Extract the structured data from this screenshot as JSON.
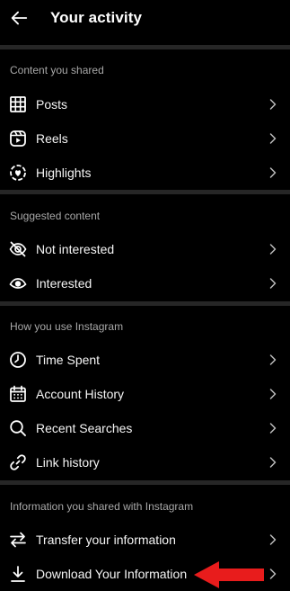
{
  "header": {
    "title": "Your activity"
  },
  "sections": [
    {
      "title": "Content you shared",
      "items": [
        {
          "label": "Posts",
          "icon": "grid-icon"
        },
        {
          "label": "Reels",
          "icon": "reels-icon"
        },
        {
          "label": "Highlights",
          "icon": "highlights-icon"
        }
      ]
    },
    {
      "title": "Suggested content",
      "items": [
        {
          "label": "Not interested",
          "icon": "eye-off-icon"
        },
        {
          "label": "Interested",
          "icon": "eye-icon"
        }
      ]
    },
    {
      "title": "How you use Instagram",
      "items": [
        {
          "label": "Time Spent",
          "icon": "clock-icon"
        },
        {
          "label": "Account History",
          "icon": "calendar-icon"
        },
        {
          "label": "Recent Searches",
          "icon": "search-icon"
        },
        {
          "label": "Link history",
          "icon": "link-icon"
        }
      ]
    },
    {
      "title": "Information you shared with Instagram",
      "items": [
        {
          "label": "Transfer your information",
          "icon": "transfer-icon"
        },
        {
          "label": "Download Your Information",
          "icon": "download-icon"
        }
      ]
    }
  ],
  "annotation": {
    "arrow_color": "#e81c1c"
  },
  "colors": {
    "background": "#000000",
    "divider": "#262626",
    "section_title": "#a8a8a8",
    "text": "#f5f5f5"
  }
}
